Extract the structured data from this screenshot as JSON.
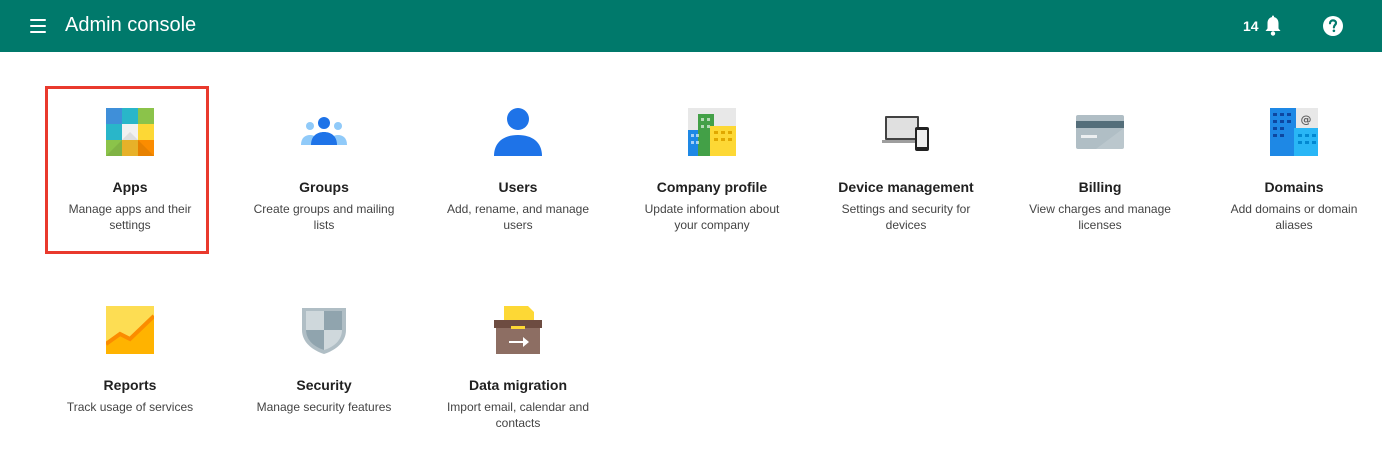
{
  "header": {
    "title": "Admin console",
    "notification_count": "14",
    "bar_color": "#00796b"
  },
  "icons": {
    "menu": "menu-icon",
    "notifications": "bell-icon",
    "help": "help-icon"
  },
  "tiles": [
    {
      "title": "Apps",
      "desc": "Manage apps and their settings",
      "icon": "apps-icon",
      "highlighted": true
    },
    {
      "title": "Groups",
      "desc": "Create groups and mailing lists",
      "icon": "groups-icon"
    },
    {
      "title": "Users",
      "desc": "Add, rename, and manage users",
      "icon": "users-icon"
    },
    {
      "title": "Company profile",
      "desc": "Update information about your company",
      "icon": "company-profile-icon"
    },
    {
      "title": "Device management",
      "desc": "Settings and security for devices",
      "icon": "device-management-icon"
    },
    {
      "title": "Billing",
      "desc": "View charges and manage licenses",
      "icon": "billing-icon"
    },
    {
      "title": "Domains",
      "desc": "Add domains or domain aliases",
      "icon": "domains-icon"
    },
    {
      "title": "Reports",
      "desc": "Track usage of services",
      "icon": "reports-icon"
    },
    {
      "title": "Security",
      "desc": "Manage security features",
      "icon": "security-icon"
    },
    {
      "title": "Data migration",
      "desc": "Import email, calendar and contacts",
      "icon": "data-migration-icon"
    }
  ],
  "highlight_color": "#e9392d"
}
